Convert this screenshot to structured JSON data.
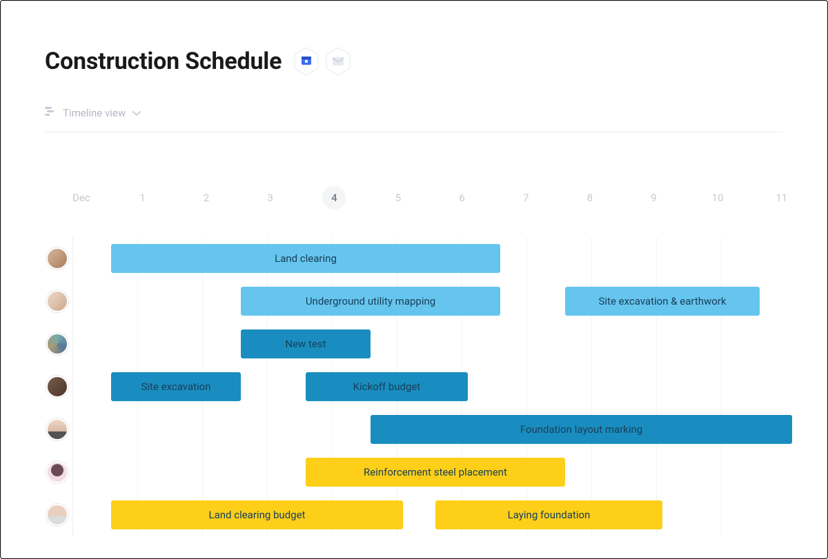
{
  "header": {
    "title": "Construction Schedule",
    "icons": {
      "calendar": "calendar-icon",
      "mail": "mail-icon"
    }
  },
  "view_selector": {
    "icon": "gantt-icon",
    "label": "Timeline view"
  },
  "timeline": {
    "month_label": "Dec",
    "days": [
      "1",
      "2",
      "3",
      "4",
      "5",
      "6",
      "7",
      "8",
      "9",
      "10",
      "11"
    ],
    "current_index": 3
  },
  "colors": {
    "light_blue": "#66c5ee",
    "dark_blue": "#1a8dc0",
    "yellow": "#fdcf19"
  },
  "chart_data": {
    "type": "gantt",
    "x_unit": "day",
    "x_range": [
      1,
      11
    ],
    "rows": [
      {
        "assignee": "user-1",
        "bars": [
          {
            "label": "Land clearing",
            "start": 1,
            "end": 7,
            "color": "light_blue"
          }
        ]
      },
      {
        "assignee": "user-2",
        "bars": [
          {
            "label": "Underground utility mapping",
            "start": 3,
            "end": 7,
            "color": "light_blue"
          },
          {
            "label": "Site excavation & earthwork",
            "start": 8,
            "end": 11,
            "color": "light_blue"
          }
        ]
      },
      {
        "assignee": "user-3",
        "bars": [
          {
            "label": "New test",
            "start": 3,
            "end": 5,
            "color": "dark_blue"
          }
        ]
      },
      {
        "assignee": "user-4",
        "bars": [
          {
            "label": "Site excavation",
            "start": 1,
            "end": 3,
            "color": "dark_blue"
          },
          {
            "label": "Kickoff budget",
            "start": 4,
            "end": 6.5,
            "color": "dark_blue"
          }
        ]
      },
      {
        "assignee": "user-5",
        "bars": [
          {
            "label": "Foundation layout marking",
            "start": 5,
            "end": 11.5,
            "color": "dark_blue"
          }
        ]
      },
      {
        "assignee": "user-6",
        "bars": [
          {
            "label": "Reinforcement steel placement",
            "start": 4,
            "end": 8,
            "color": "yellow"
          }
        ]
      },
      {
        "assignee": "user-7",
        "bars": [
          {
            "label": "Land clearing budget",
            "start": 1,
            "end": 5.5,
            "color": "yellow"
          },
          {
            "label": "Laying foundation",
            "start": 6,
            "end": 9.5,
            "color": "yellow"
          }
        ]
      }
    ]
  }
}
